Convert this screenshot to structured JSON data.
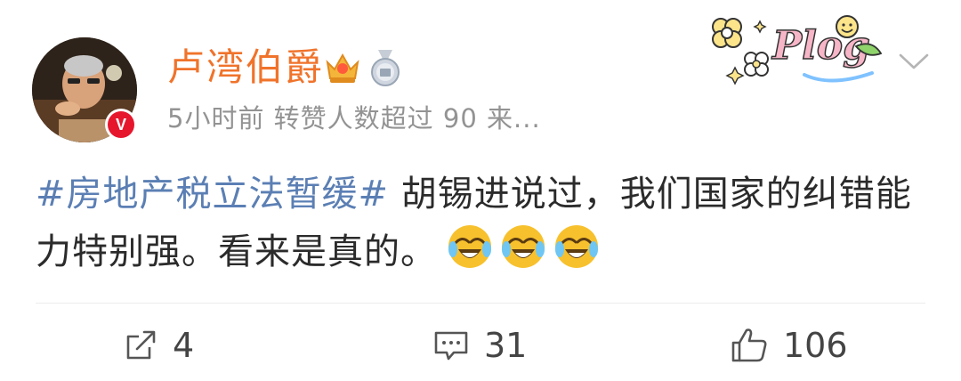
{
  "post": {
    "author": {
      "name": "卢湾伯爵",
      "badges": [
        "crown-badge-icon",
        "medal-badge-icon"
      ],
      "verified": true,
      "verified_badge_letter": "V"
    },
    "meta": "5小时前  转赞人数超过 90  来...",
    "hashtag": "#房地产税立法暂缓#",
    "text": " 胡锡进说过，我们国家的纠错能力特别强。看来是真的。",
    "emojis": [
      "laugh-cry-emoji",
      "laugh-cry-emoji",
      "laugh-cry-emoji"
    ],
    "decoration_label": "Plog"
  },
  "actions": {
    "share_count": "4",
    "comment_count": "31",
    "like_count": "106"
  },
  "colors": {
    "username": "#f0732b",
    "hashtag": "#5b7fb4",
    "meta": "#939393",
    "verified": "#e6162d"
  }
}
